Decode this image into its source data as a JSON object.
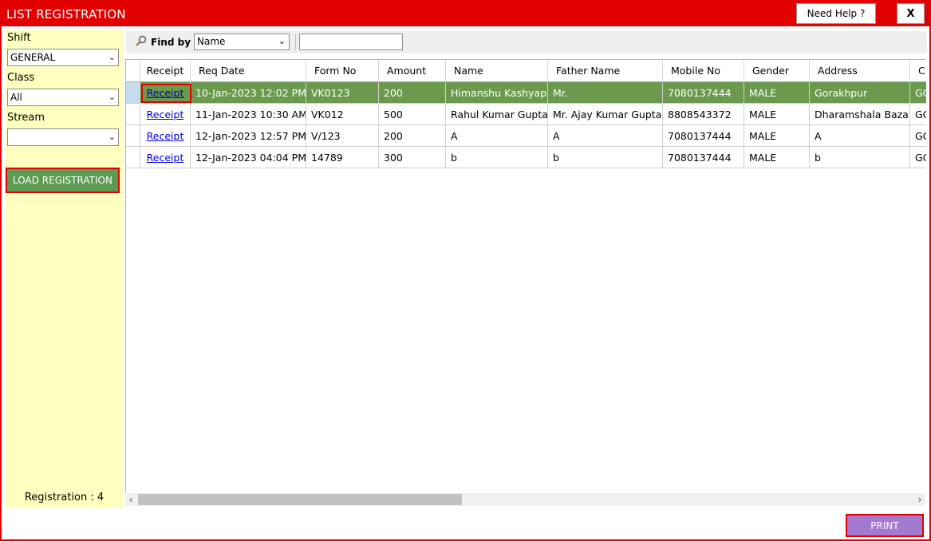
{
  "window": {
    "title": "LIST REGISTRATION",
    "help_label": "Need Help ?",
    "close_label": "X"
  },
  "sidebar": {
    "shift_label": "Shift",
    "shift_value": "GENERAL",
    "class_label": "Class",
    "class_value": "All",
    "stream_label": "Stream",
    "stream_value": "",
    "load_button": "LOAD REGISTRATION",
    "registration_count": "Registration : 4"
  },
  "toolbar": {
    "find_label": "Find by",
    "find_field": "Name",
    "search_value": ""
  },
  "table": {
    "columns": [
      "Receipt",
      "Req Date",
      "Form No",
      "Amount",
      "Name",
      "Father Name",
      "Mobile No",
      "Gender",
      "Address",
      "C"
    ],
    "rows": [
      [
        "Receipt",
        "10-Jan-2023 12:02 PM",
        "VK0123",
        "200",
        "Himanshu Kashyap",
        "Mr.",
        "7080137444",
        "MALE",
        "Gorakhpur",
        "GC"
      ],
      [
        "Receipt",
        "11-Jan-2023 10:30 AM",
        "VK012",
        "500",
        "Rahul Kumar Gupta",
        "Mr. Ajay Kumar Gupta",
        "8808543372",
        "MALE",
        "Dharamshala Bazar",
        "GC"
      ],
      [
        "Receipt",
        "12-Jan-2023 12:57 PM",
        "V/123",
        "200",
        "A",
        "A",
        "7080137444",
        "MALE",
        "A",
        "GC"
      ],
      [
        "Receipt",
        "12-Jan-2023 04:04 PM",
        "14789",
        "300",
        "b",
        "b",
        "7080137444",
        "MALE",
        "b",
        "GC"
      ]
    ],
    "selected_row": 0
  },
  "footer": {
    "print_label": "PRINT"
  },
  "colors": {
    "title_bar": "#e30000",
    "sidebar_bg": "#ffffc0",
    "selected_row": "#6b9a4e",
    "load_button": "#5e9b52",
    "print_button": "#a479d2"
  }
}
